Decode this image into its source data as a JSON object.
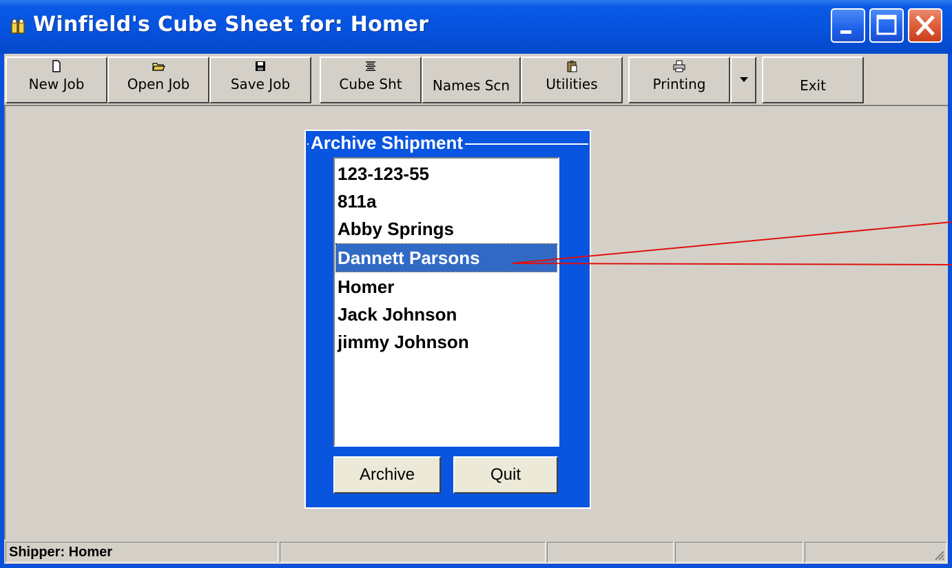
{
  "window": {
    "title": "Winfield's Cube Sheet for: Homer",
    "title_icon": "app-icon",
    "controls": [
      "minimize-icon",
      "maximize-icon",
      "close-icon"
    ],
    "accent_color": "#0a55e0"
  },
  "toolbar": {
    "new_job": "New Job",
    "open_job": "Open Job",
    "save_job": "Save Job",
    "cube_sht": "Cube Sht",
    "names_scn": "Names Scn",
    "utilities": "Utilities",
    "printing": "Printing",
    "exit": "Exit"
  },
  "archive_panel": {
    "title": "Archive Shipment",
    "items": [
      "123-123-55",
      "811a",
      "Abby Springs",
      "Dannett Parsons",
      "Homer",
      "Jack Johnson",
      "jimmy Johnson"
    ],
    "selected": "Dannett Parsons",
    "archive_button": "Archive",
    "quit_button": "Quit"
  },
  "statusbar": {
    "shipper": "Shipper: Homer"
  }
}
